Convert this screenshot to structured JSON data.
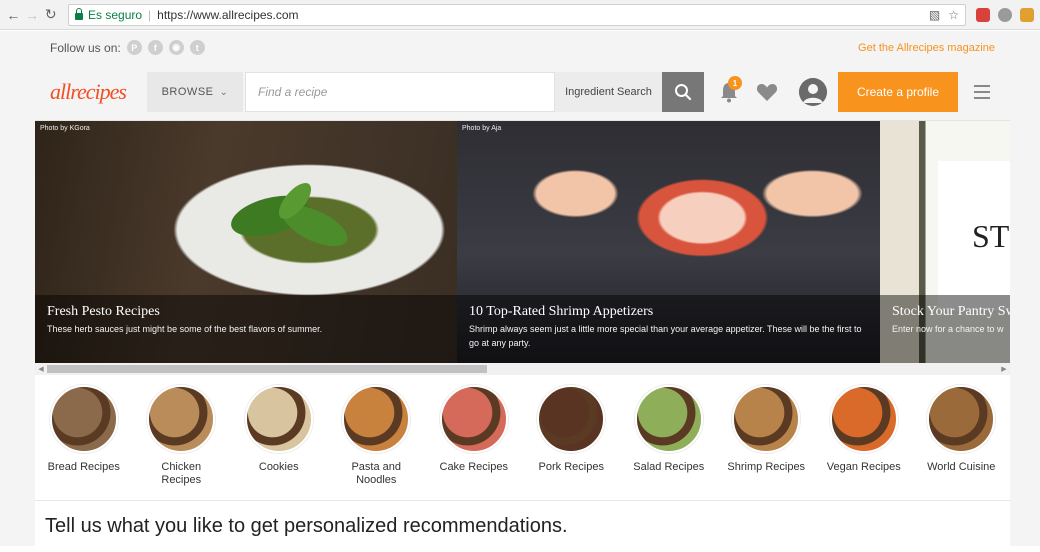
{
  "browser": {
    "secure_label": "Es seguro",
    "url": "https://www.allrecipes.com"
  },
  "follow_bar": {
    "label": "Follow us on:",
    "magazine_link": "Get the Allrecipes magazine"
  },
  "header": {
    "logo": "allrecipes",
    "browse_label": "BROWSE",
    "search_placeholder": "Find a recipe",
    "ingredient_search_label": "Ingredient Search",
    "notification_count": "1",
    "create_profile_label": "Create a profile"
  },
  "carousel": {
    "slides": [
      {
        "photo_credit": "Photo by KGora",
        "title": "Fresh Pesto Recipes",
        "description": "These herb sauces just might be some of the best flavors of summer."
      },
      {
        "photo_credit": "Photo by Aja",
        "title": "10 Top-Rated Shrimp Appetizers",
        "description": "Shrimp always seem just a little more special than your average appetizer. These will be the first to go at any party."
      },
      {
        "photo_credit": "",
        "title": "Stock Your Pantry Sw",
        "description": "Enter now for a chance to w",
        "image_text": "ST"
      }
    ]
  },
  "categories": [
    {
      "label": "Bread Recipes",
      "color": "#8a6a4a"
    },
    {
      "label": "Chicken Recipes",
      "color": "#b98c5a"
    },
    {
      "label": "Cookies",
      "color": "#d9c4a0"
    },
    {
      "label": "Pasta and Noodles",
      "color": "#c9823e"
    },
    {
      "label": "Cake Recipes",
      "color": "#d56a5a"
    },
    {
      "label": "Pork Recipes",
      "color": "#5a3422"
    },
    {
      "label": "Salad Recipes",
      "color": "#8fae5a"
    },
    {
      "label": "Shrimp Recipes",
      "color": "#b8834a"
    },
    {
      "label": "Vegan Recipes",
      "color": "#d96a2a"
    },
    {
      "label": "World Cuisine",
      "color": "#9a6a3a"
    }
  ],
  "personalize_heading": "Tell us what you like to get personalized recommendations.",
  "colors": {
    "accent": "#f8931d",
    "logo": "#f15025"
  }
}
